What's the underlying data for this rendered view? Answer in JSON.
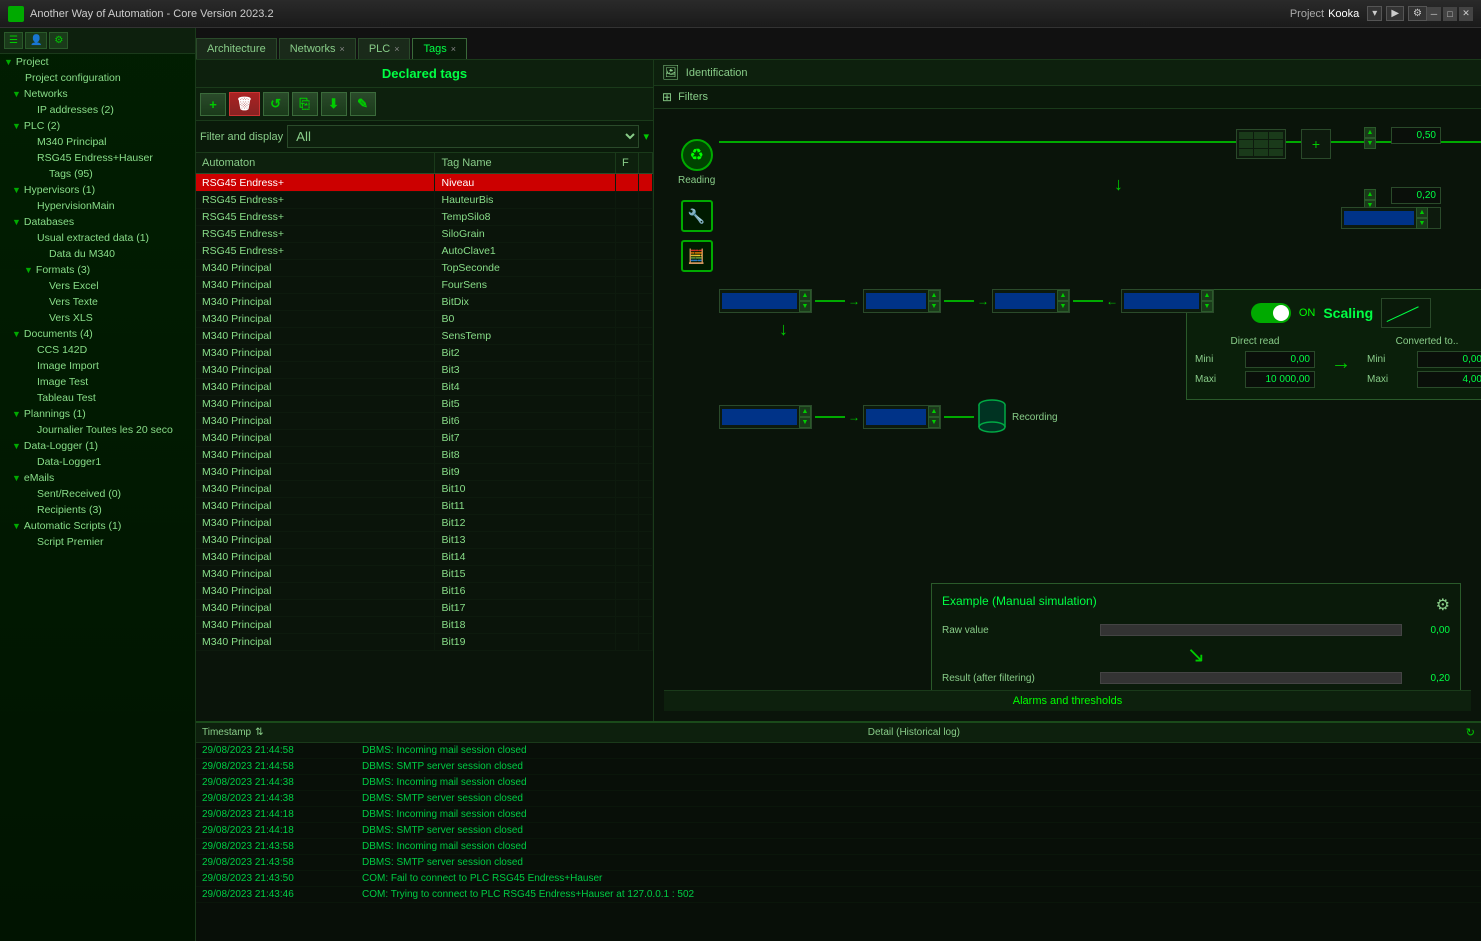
{
  "app": {
    "title": "Another Way of Automation - Core Version 2023.2",
    "project_label": "Project",
    "project_name": "Kooka"
  },
  "tabs": [
    {
      "id": "architecture",
      "label": "Architecture",
      "closable": false,
      "active": false
    },
    {
      "id": "networks",
      "label": "Networks",
      "closable": true,
      "active": false
    },
    {
      "id": "plc",
      "label": "PLC",
      "closable": true,
      "active": false
    },
    {
      "id": "tags",
      "label": "Tags",
      "closable": true,
      "active": true
    }
  ],
  "tags_panel": {
    "title": "Declared tags",
    "filter_label": "Filter and display",
    "filter_value": "All",
    "columns": [
      "Automaton",
      "Tag Name",
      "F"
    ],
    "toolbar": {
      "add": "+",
      "delete": "🗑",
      "refresh": "↺",
      "copy": "⎘",
      "download": "⬇",
      "edit": "✎"
    }
  },
  "tags": [
    {
      "automaton": "RSG45 Endress+",
      "name": "Niveau",
      "flag": true,
      "selected": true
    },
    {
      "automaton": "RSG45 Endress+",
      "name": "HauteurBis",
      "flag": false
    },
    {
      "automaton": "RSG45 Endress+",
      "name": "TempSilo8",
      "flag": false
    },
    {
      "automaton": "RSG45 Endress+",
      "name": "SiloGrain",
      "flag": false
    },
    {
      "automaton": "RSG45 Endress+",
      "name": "AutoClave1",
      "flag": false
    },
    {
      "automaton": "M340 Principal",
      "name": "TopSeconde",
      "flag": false
    },
    {
      "automaton": "M340 Principal",
      "name": "FourSens",
      "flag": false
    },
    {
      "automaton": "M340 Principal",
      "name": "BitDix",
      "flag": false
    },
    {
      "automaton": "M340 Principal",
      "name": "B0",
      "flag": false
    },
    {
      "automaton": "M340 Principal",
      "name": "SensTemp",
      "flag": false
    },
    {
      "automaton": "M340 Principal",
      "name": "Bit2",
      "flag": false
    },
    {
      "automaton": "M340 Principal",
      "name": "Bit3",
      "flag": false
    },
    {
      "automaton": "M340 Principal",
      "name": "Bit4",
      "flag": false
    },
    {
      "automaton": "M340 Principal",
      "name": "Bit5",
      "flag": false
    },
    {
      "automaton": "M340 Principal",
      "name": "Bit6",
      "flag": false
    },
    {
      "automaton": "M340 Principal",
      "name": "Bit7",
      "flag": false
    },
    {
      "automaton": "M340 Principal",
      "name": "Bit8",
      "flag": false
    },
    {
      "automaton": "M340 Principal",
      "name": "Bit9",
      "flag": false
    },
    {
      "automaton": "M340 Principal",
      "name": "Bit10",
      "flag": false
    },
    {
      "automaton": "M340 Principal",
      "name": "Bit11",
      "flag": false
    },
    {
      "automaton": "M340 Principal",
      "name": "Bit12",
      "flag": false
    },
    {
      "automaton": "M340 Principal",
      "name": "Bit13",
      "flag": false
    },
    {
      "automaton": "M340 Principal",
      "name": "Bit14",
      "flag": false
    },
    {
      "automaton": "M340 Principal",
      "name": "Bit15",
      "flag": false
    },
    {
      "automaton": "M340 Principal",
      "name": "Bit16",
      "flag": false
    },
    {
      "automaton": "M340 Principal",
      "name": "Bit17",
      "flag": false
    },
    {
      "automaton": "M340 Principal",
      "name": "Bit18",
      "flag": false
    },
    {
      "automaton": "M340 Principal",
      "name": "Bit19",
      "flag": false
    }
  ],
  "diagram": {
    "identification_label": "Identification",
    "filters_label": "Filters",
    "reading_label": "Reading",
    "scaling": {
      "title": "Scaling",
      "on_label": "ON",
      "direct_read_label": "Direct read",
      "converted_label": "Converted to..",
      "mini_label": "Mini",
      "maxi_label": "Maxi",
      "direct_mini": "0,00",
      "direct_maxi": "10 000,00",
      "converted_mini": "0,00",
      "converted_maxi": "4,00"
    },
    "chain1_val1": "0,50",
    "chain1_val2": "0,20",
    "recording_label": "Recording",
    "example": {
      "title": "Example (Manual simulation)",
      "raw_label": "Raw value",
      "raw_value": "0,00",
      "result_label": "Result (after filtering)",
      "result_value": "0,20"
    },
    "alarms_label": "Alarms and thresholds"
  },
  "sidebar": {
    "items": [
      {
        "id": "project",
        "label": "Project",
        "level": 0,
        "expanded": true,
        "type": "folder"
      },
      {
        "id": "project-config",
        "label": "Project configuration",
        "level": 1,
        "type": "item"
      },
      {
        "id": "networks",
        "label": "Networks",
        "level": 1,
        "expanded": true,
        "type": "folder"
      },
      {
        "id": "ip-addresses",
        "label": "IP addresses (2)",
        "level": 2,
        "type": "item"
      },
      {
        "id": "plc",
        "label": "PLC (2)",
        "level": 1,
        "expanded": true,
        "type": "folder"
      },
      {
        "id": "m340",
        "label": "M340 Principal",
        "level": 2,
        "type": "item"
      },
      {
        "id": "rsg45",
        "label": "RSG45 Endress+Hauser",
        "level": 2,
        "type": "item"
      },
      {
        "id": "tags95",
        "label": "Tags (95)",
        "level": 3,
        "type": "item"
      },
      {
        "id": "hypervisors",
        "label": "Hypervisors (1)",
        "level": 1,
        "expanded": true,
        "type": "folder"
      },
      {
        "id": "hvmain",
        "label": "HypervisionMain",
        "level": 2,
        "type": "item"
      },
      {
        "id": "databases",
        "label": "Databases",
        "level": 1,
        "expanded": true,
        "type": "folder"
      },
      {
        "id": "usual-data",
        "label": "Usual extracted data (1)",
        "level": 2,
        "type": "folder"
      },
      {
        "id": "m340-data",
        "label": "Data du M340",
        "level": 3,
        "type": "item"
      },
      {
        "id": "formats",
        "label": "Formats (3)",
        "level": 2,
        "expanded": true,
        "type": "folder"
      },
      {
        "id": "vers-excel",
        "label": "Vers Excel",
        "level": 3,
        "type": "item"
      },
      {
        "id": "vers-texte",
        "label": "Vers Texte",
        "level": 3,
        "type": "item"
      },
      {
        "id": "vers-xls",
        "label": "Vers XLS",
        "level": 3,
        "type": "item"
      },
      {
        "id": "documents",
        "label": "Documents (4)",
        "level": 1,
        "expanded": true,
        "type": "folder"
      },
      {
        "id": "ccs142d",
        "label": "CCS 142D",
        "level": 2,
        "type": "item"
      },
      {
        "id": "image-import",
        "label": "Image Import",
        "level": 2,
        "type": "item"
      },
      {
        "id": "image-test",
        "label": "Image Test",
        "level": 2,
        "type": "item"
      },
      {
        "id": "tableau-test",
        "label": "Tableau Test",
        "level": 2,
        "type": "item"
      },
      {
        "id": "plannings",
        "label": "Plannings (1)",
        "level": 1,
        "expanded": true,
        "type": "folder"
      },
      {
        "id": "journalier",
        "label": "Journalier Toutes les 20 seco",
        "level": 2,
        "type": "item"
      },
      {
        "id": "datalogger",
        "label": "Data-Logger (1)",
        "level": 1,
        "expanded": true,
        "type": "folder"
      },
      {
        "id": "datalogger1",
        "label": "Data-Logger1",
        "level": 2,
        "type": "item"
      },
      {
        "id": "emails",
        "label": "eMails",
        "level": 1,
        "expanded": true,
        "type": "folder"
      },
      {
        "id": "sent-received",
        "label": "Sent/Received (0)",
        "level": 2,
        "type": "item"
      },
      {
        "id": "recipients",
        "label": "Recipients (3)",
        "level": 2,
        "type": "item"
      },
      {
        "id": "auto-scripts",
        "label": "Automatic Scripts (1)",
        "level": 1,
        "expanded": true,
        "type": "folder"
      },
      {
        "id": "script-premier",
        "label": "Script Premier",
        "level": 2,
        "type": "item"
      }
    ]
  },
  "log": {
    "ts_header": "Timestamp",
    "detail_header": "Detail (Historical log)",
    "entries": [
      {
        "ts": "29/08/2023 21:44:58",
        "detail": "DBMS: Incoming mail session closed"
      },
      {
        "ts": "29/08/2023 21:44:58",
        "detail": "DBMS: SMTP server session closed"
      },
      {
        "ts": "29/08/2023 21:44:38",
        "detail": "DBMS: Incoming mail session closed"
      },
      {
        "ts": "29/08/2023 21:44:38",
        "detail": "DBMS: SMTP server session closed"
      },
      {
        "ts": "29/08/2023 21:44:18",
        "detail": "DBMS: Incoming mail session closed"
      },
      {
        "ts": "29/08/2023 21:44:18",
        "detail": "DBMS: SMTP server session closed"
      },
      {
        "ts": "29/08/2023 21:43:58",
        "detail": "DBMS: Incoming mail session closed"
      },
      {
        "ts": "29/08/2023 21:43:58",
        "detail": "DBMS: SMTP server session closed"
      },
      {
        "ts": "29/08/2023 21:43:50",
        "detail": "COM: Fail to connect to PLC RSG45 Endress+Hauser"
      },
      {
        "ts": "29/08/2023 21:43:46",
        "detail": "COM: Trying to connect to PLC RSG45 Endress+Hauser at 127.0.0.1 : 502"
      }
    ]
  }
}
